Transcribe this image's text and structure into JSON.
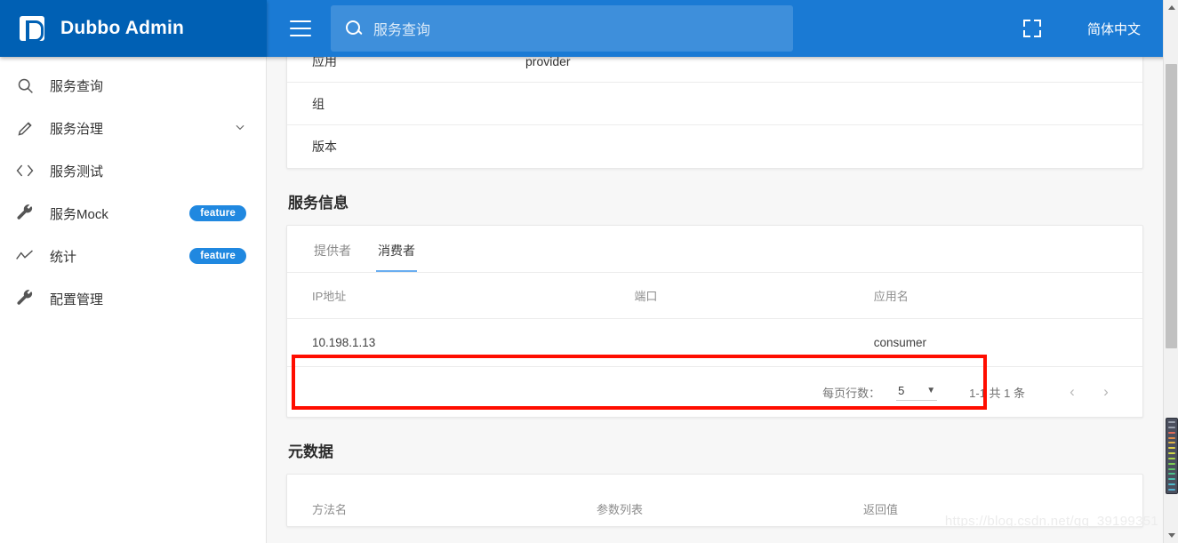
{
  "brand": {
    "title": "Dubbo Admin",
    "logo_icon": "dubbo-logo-icon"
  },
  "topbar": {
    "menu_icon": "hamburger-menu-icon",
    "search": {
      "icon": "search-icon",
      "value": "",
      "placeholder": "服务查询"
    },
    "fullscreen_icon": "fullscreen-icon",
    "language": "简体中文"
  },
  "sidebar": {
    "items": [
      {
        "label": "服务查询",
        "icon": "search-icon",
        "badge": "",
        "chevron": ""
      },
      {
        "label": "服务治理",
        "icon": "pencil-icon",
        "badge": "",
        "chevron": "⌄"
      },
      {
        "label": "服务测试",
        "icon": "code-brackets-icon",
        "badge": "",
        "chevron": ""
      },
      {
        "label": "服务Mock",
        "icon": "wrench-icon",
        "badge": "feature",
        "chevron": ""
      },
      {
        "label": "统计",
        "icon": "line-chart-icon",
        "badge": "feature",
        "chevron": ""
      },
      {
        "label": "配置管理",
        "icon": "wrench-icon",
        "badge": "",
        "chevron": ""
      }
    ]
  },
  "main": {
    "info_table": {
      "rows": [
        {
          "key": "应用",
          "value": "provider"
        },
        {
          "key": "组",
          "value": ""
        },
        {
          "key": "版本",
          "value": ""
        }
      ]
    },
    "service_info": {
      "title": "服务信息",
      "tabs": [
        {
          "label": "提供者",
          "active": false
        },
        {
          "label": "消费者",
          "active": true
        }
      ],
      "columns": [
        "IP地址",
        "端口",
        "应用名"
      ],
      "rows": [
        {
          "ip": "10.198.1.13",
          "port": "",
          "app": "consumer"
        }
      ],
      "pagination": {
        "rows_per_page_label": "每页行数：",
        "rows_per_page_value": "5",
        "caret_icon": "chevron-down-icon",
        "range_text": "1-1 共 1 条",
        "prev_icon": "chevron-left-icon",
        "next_icon": "chevron-right-icon"
      }
    },
    "metadata": {
      "title": "元数据",
      "columns": [
        "方法名",
        "参数列表",
        "返回值"
      ]
    }
  },
  "annotation": {
    "highlight_color": "#ff0d00"
  },
  "watermark": {
    "text": "https://blog.csdn.net/qq_39199351"
  },
  "scrollbar": {
    "up_icon": "scroll-up-arrow-icon",
    "down_icon": "scroll-down-arrow-icon",
    "thumb_icon": "scrollbar-thumb"
  },
  "colors": {
    "brand_dark_blue": "#0060b4",
    "topbar_blue": "#1a7ad4",
    "badge_blue": "#2088e0",
    "tab_active_underline": "#6aaef0",
    "content_bg": "#f7f7f7"
  }
}
